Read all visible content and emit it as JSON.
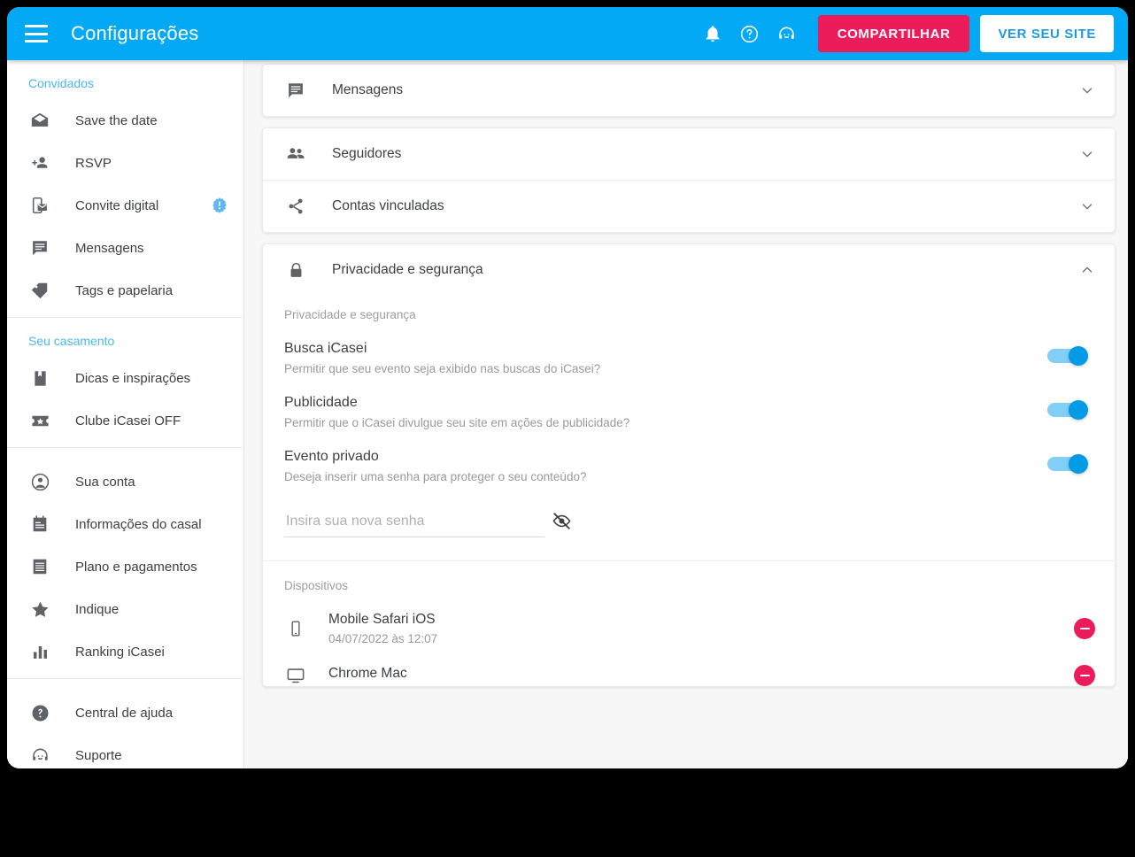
{
  "topbar": {
    "menu_icon": "hamburger-menu-icon",
    "title": "Configurações",
    "notification_icon": "bell-icon",
    "help_icon": "help-circle-icon",
    "support_icon": "support-agent-icon",
    "share_label": "COMPARTILHAR",
    "site_label": "VER SEU SITE",
    "bg_color": "#03A9F4",
    "share_color": "#EC1B5A",
    "site_text_color": "#1E9BE0"
  },
  "sidebar": {
    "groups": [
      {
        "title": "Convidados",
        "items": [
          {
            "label": "Save the date",
            "icon": "mail-open-icon",
            "badge": null
          },
          {
            "label": "RSVP",
            "icon": "person-add-icon",
            "badge": null
          },
          {
            "label": "Convite digital",
            "icon": "mobile-invite-icon",
            "badge": "alert-badge-icon"
          },
          {
            "label": "Mensagens",
            "icon": "message-icon",
            "badge": null
          },
          {
            "label": "Tags e papelaria",
            "icon": "tag-icon",
            "badge": null
          }
        ]
      },
      {
        "title": "Seu casamento",
        "items": [
          {
            "label": "Dicas e inspirações",
            "icon": "bookmark-book-icon",
            "badge": null
          },
          {
            "label": "Clube iCasei OFF",
            "icon": "ticket-star-icon",
            "badge": null
          }
        ]
      },
      {
        "title": "",
        "items": [
          {
            "label": "Sua conta",
            "icon": "account-circle-icon",
            "badge": null
          },
          {
            "label": "Informações do casal",
            "icon": "calendar-note-icon",
            "badge": null
          },
          {
            "label": "Plano e pagamentos",
            "icon": "receipt-icon",
            "badge": null
          },
          {
            "label": "Indique",
            "icon": "star-icon",
            "badge": null
          },
          {
            "label": "Ranking iCasei",
            "icon": "bar-chart-icon",
            "badge": null
          }
        ]
      },
      {
        "title": "",
        "items": [
          {
            "label": "Central de ajuda",
            "icon": "help-circle-filled-icon",
            "badge": null
          },
          {
            "label": "Suporte",
            "icon": "support-agent-icon",
            "badge": null
          }
        ]
      }
    ],
    "group_title_color": "#49B9F3"
  },
  "main": {
    "sections": [
      {
        "label": "Mensagens",
        "icon": "message-icon",
        "state": "collapsed",
        "chevron": "chevron-down-icon"
      },
      {
        "label": "Seguidores",
        "icon": "people-icon",
        "state": "collapsed",
        "chevron": "chevron-down-icon"
      },
      {
        "label": "Contas vinculadas",
        "icon": "share-icon",
        "state": "collapsed",
        "chevron": "chevron-down-icon"
      }
    ],
    "privacy": {
      "header_label": "Privacidade e segurança",
      "header_icon": "lock-icon",
      "chevron": "chevron-up-icon",
      "state": "expanded",
      "subtitle": "Privacidade e segurança",
      "options": [
        {
          "name": "Busca iCasei",
          "description": "Permitir que seu evento seja exibido nas buscas do iCasei?",
          "toggle_on": true
        },
        {
          "name": "Publicidade",
          "description": "Permitir que o iCasei divulgue seu site em ações de publicidade?",
          "toggle_on": true
        },
        {
          "name": "Evento privado",
          "description": "Deseja inserir uma senha para proteger o seu conteúdo?",
          "toggle_on": true
        }
      ],
      "password": {
        "placeholder": "Insira sua nova senha",
        "value": "",
        "toggle_visibility_icon": "eye-off-icon"
      },
      "devices_title": "Dispositivos",
      "devices": [
        {
          "name": "Mobile Safari iOS",
          "date": "04/07/2022 às 12:07",
          "icon": "smartphone-icon",
          "remove_icon": "remove-circle-icon"
        },
        {
          "name": "Chrome Mac",
          "date": "",
          "icon": "desktop-icon",
          "remove_icon": "remove-circle-icon"
        }
      ],
      "toggle_on_color": "#039BE5",
      "toggle_track_color": "#81CFF7",
      "remove_color": "#EC1B5A"
    }
  }
}
